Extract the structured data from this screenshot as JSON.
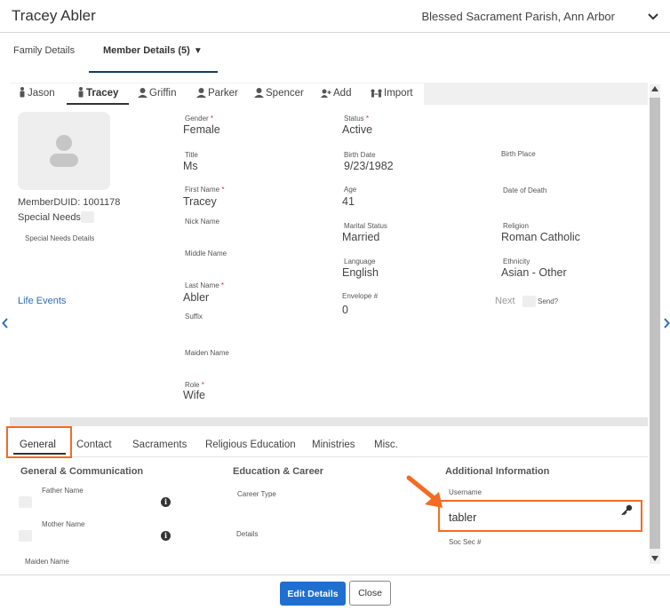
{
  "header": {
    "title": "Tracey Abler",
    "parish": "Blessed Sacrament Parish, Ann Arbor"
  },
  "top_tabs": [
    {
      "label": "Family Details"
    },
    {
      "label": "Member Details (5)",
      "caret": "▼"
    }
  ],
  "member_tabs": [
    {
      "label": "Jason"
    },
    {
      "label": "Tracey"
    },
    {
      "label": "Griffin"
    },
    {
      "label": "Parker"
    },
    {
      "label": "Spencer"
    },
    {
      "label": "Add"
    },
    {
      "label": "Import"
    }
  ],
  "member": {
    "duid_label": "MemberDUID: 1001178",
    "special_needs": "Special Needs",
    "special_needs_details": "Special Needs Details",
    "life_events": "Life Events",
    "fields": {
      "gender": {
        "label": "Gender",
        "value": "Female"
      },
      "status": {
        "label": "Status",
        "value": "Active"
      },
      "title": {
        "label": "Title",
        "value": "Ms"
      },
      "birth_date": {
        "label": "Birth Date",
        "value": "9/23/1982"
      },
      "birth_place": {
        "label": "Birth Place"
      },
      "first_name": {
        "label": "First Name",
        "value": "Tracey"
      },
      "age": {
        "label": "Age",
        "value": "41"
      },
      "date_of_death": {
        "label": "Date of Death"
      },
      "nick_name": {
        "label": "Nick Name"
      },
      "marital_status": {
        "label": "Marital Status",
        "value": "Married"
      },
      "religion": {
        "label": "Religion",
        "value": "Roman Catholic"
      },
      "middle_name": {
        "label": "Middle Name"
      },
      "language": {
        "label": "Language",
        "value": "English"
      },
      "ethnicity": {
        "label": "Ethnicity",
        "value": "Asian - Other"
      },
      "last_name": {
        "label": "Last Name",
        "value": "Abler"
      },
      "envelope": {
        "label": "Envelope #",
        "value": "0"
      },
      "next": "Next",
      "send": "Send?",
      "suffix": {
        "label": "Suffix"
      },
      "maiden_name": {
        "label": "Maiden Name"
      },
      "role": {
        "label": "Role",
        "value": "Wife"
      }
    },
    "required_mark": "*"
  },
  "bottom_tabs": [
    {
      "label": "General"
    },
    {
      "label": "Contact"
    },
    {
      "label": "Sacraments"
    },
    {
      "label": "Religious Education"
    },
    {
      "label": "Ministries"
    },
    {
      "label": "Misc."
    }
  ],
  "general": {
    "sections": {
      "comm": "General & Communication",
      "edu": "Education & Career",
      "additional": "Additional Information"
    },
    "father_name": "Father Name",
    "mother_name": "Mother Name",
    "maiden_name": "Maiden Name",
    "career_type": "Career Type",
    "details": "Details",
    "username_label": "Username",
    "username_value": "tabler",
    "soc_sec": "Soc Sec #",
    "info_glyph": "i"
  },
  "footer": {
    "edit": "Edit Details",
    "close": "Close"
  },
  "colors": {
    "accent_orange": "#f26c21",
    "primary_blue": "#1f6fd0",
    "link_blue": "#2a6fb5",
    "nav_dark": "#123e5c"
  }
}
